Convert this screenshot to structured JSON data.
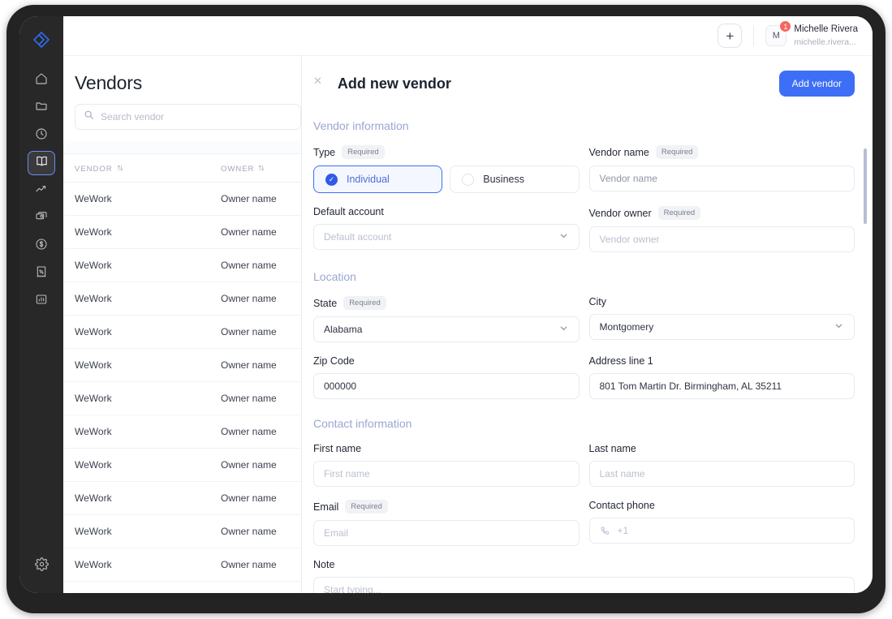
{
  "sidebar": {
    "logo_icon": "brand-diamond-logo",
    "items": [
      {
        "icon": "home-icon",
        "name": "home",
        "active": false
      },
      {
        "icon": "folder-icon",
        "name": "folder",
        "active": false
      },
      {
        "icon": "clock-icon",
        "name": "history",
        "active": false
      },
      {
        "icon": "book-icon",
        "name": "vendors",
        "active": true
      },
      {
        "icon": "trending-up-icon",
        "name": "analytics",
        "active": false
      },
      {
        "icon": "cards-icon",
        "name": "payments",
        "active": false
      },
      {
        "icon": "dollar-circle-icon",
        "name": "billing",
        "active": false
      },
      {
        "icon": "receipt-percent-icon",
        "name": "taxes",
        "active": false
      },
      {
        "icon": "bar-chart-icon",
        "name": "reports",
        "active": false
      }
    ],
    "settings_icon": "gear-icon"
  },
  "topbar": {
    "add_label": "+",
    "user": {
      "initial": "M",
      "badge_count": "1",
      "name": "Michelle Rivera",
      "email": "michelle.rivera..."
    }
  },
  "list": {
    "title": "Vendors",
    "search_placeholder": "Search vendor",
    "search_value": "",
    "search_icon": "search-icon",
    "columns": [
      {
        "label": "VENDOR",
        "sort_icon": "sort-arrows-icon"
      },
      {
        "label": "OWNER",
        "sort_icon": "sort-arrows-icon"
      }
    ],
    "rows": [
      {
        "vendor": "WeWork",
        "owner": "Owner name"
      },
      {
        "vendor": "WeWork",
        "owner": "Owner name"
      },
      {
        "vendor": "WeWork",
        "owner": "Owner name"
      },
      {
        "vendor": "WeWork",
        "owner": "Owner name"
      },
      {
        "vendor": "WeWork",
        "owner": "Owner name"
      },
      {
        "vendor": "WeWork",
        "owner": "Owner name"
      },
      {
        "vendor": "WeWork",
        "owner": "Owner name"
      },
      {
        "vendor": "WeWork",
        "owner": "Owner name"
      },
      {
        "vendor": "WeWork",
        "owner": "Owner name"
      },
      {
        "vendor": "WeWork",
        "owner": "Owner name"
      },
      {
        "vendor": "WeWork",
        "owner": "Owner name"
      },
      {
        "vendor": "WeWork",
        "owner": "Owner name"
      }
    ]
  },
  "form": {
    "close_icon": "close-icon",
    "title": "Add new vendor",
    "submit_label": "Add vendor",
    "sections": {
      "vendor_information": "Vendor information",
      "location": "Location",
      "contact_information": "Contact information"
    },
    "required_badge": "Required",
    "type": {
      "label": "Type",
      "options": [
        {
          "label": "Individual",
          "selected": true
        },
        {
          "label": "Business",
          "selected": false
        }
      ],
      "check_icon": "check-icon"
    },
    "vendor_name": {
      "label": "Vendor name",
      "value": "",
      "placeholder": "Vendor name"
    },
    "default_account": {
      "label": "Default account",
      "value": "",
      "placeholder": "Default account",
      "chevron_icon": "chevron-down-icon"
    },
    "vendor_owner": {
      "label": "Vendor owner",
      "value": "",
      "placeholder": "Vendor owner"
    },
    "state": {
      "label": "State",
      "value": "Alabama",
      "chevron_icon": "chevron-down-icon"
    },
    "city": {
      "label": "City",
      "value": "Montgomery",
      "chevron_icon": "chevron-down-icon"
    },
    "zip_code": {
      "label": "Zip Code",
      "value": "000000"
    },
    "address_line_1": {
      "label": "Address line 1",
      "value": "801 Tom Martin Dr. Birmingham, AL 35211"
    },
    "first_name": {
      "label": "First name",
      "value": "",
      "placeholder": "First name"
    },
    "last_name": {
      "label": "Last name",
      "value": "",
      "placeholder": "Last name"
    },
    "email": {
      "label": "Email",
      "value": "",
      "placeholder": "Email"
    },
    "contact_phone": {
      "label": "Contact phone",
      "value": "+1",
      "phone_icon": "phone-icon"
    },
    "note": {
      "label": "Note",
      "value": "",
      "placeholder": "Start typing..."
    }
  },
  "colors": {
    "accent": "#3d6ef6",
    "rail_bg": "#282828",
    "badge": "#f4685e",
    "section_heading": "#9aa6d0"
  }
}
